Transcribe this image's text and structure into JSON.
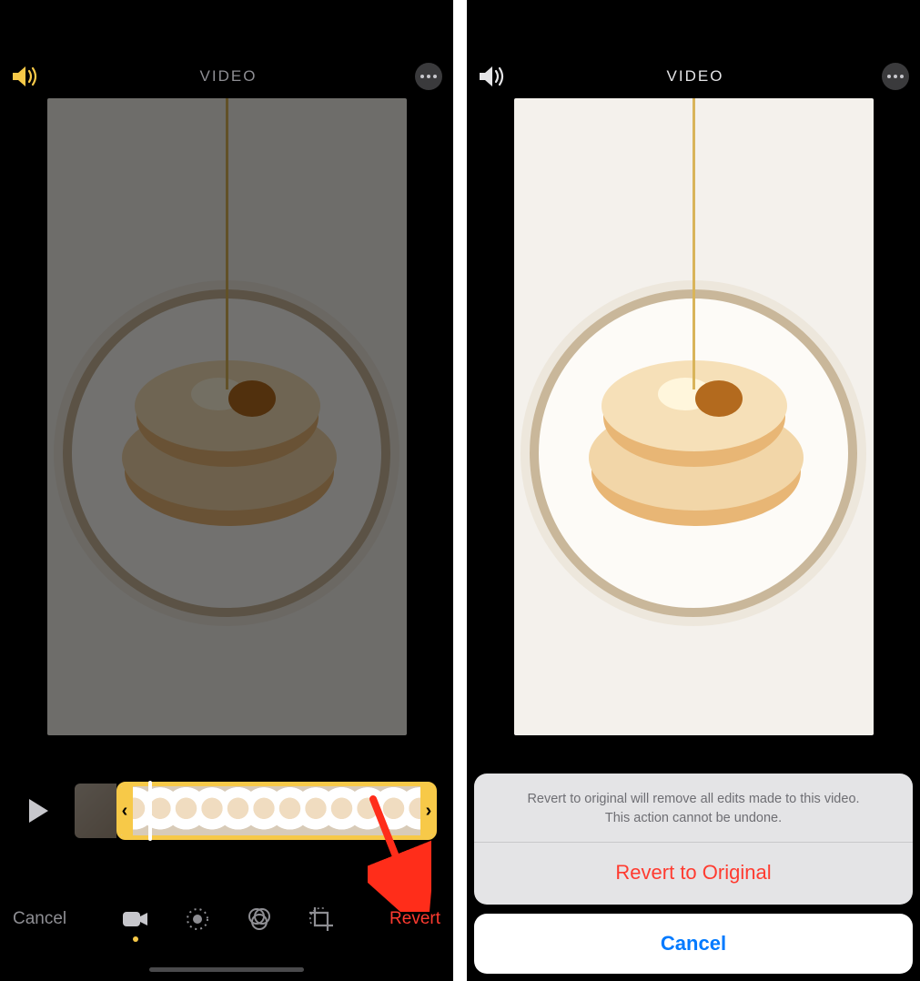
{
  "left": {
    "title": "VIDEO",
    "sound_icon": "sound-on-icon",
    "more_icon": "more-icon",
    "play_icon": "play-icon",
    "trim_left_glyph": "‹",
    "trim_right_glyph": "›",
    "toolbar": {
      "cancel": "Cancel",
      "revert": "Revert",
      "tools": {
        "video": "video-icon",
        "adjust": "adjust-icon",
        "filters": "filters-icon",
        "crop": "crop-icon"
      }
    }
  },
  "right": {
    "title": "VIDEO",
    "sound_icon": "sound-on-icon",
    "more_icon": "more-icon",
    "sheet": {
      "message_line1": "Revert to original will remove all edits made to this video.",
      "message_line2": "This action cannot be undone.",
      "revert_action": "Revert to Original",
      "cancel": "Cancel"
    }
  },
  "colors": {
    "accent_yellow": "#F7C948",
    "accent_red": "#FF3B30",
    "accent_blue": "#007AFF"
  }
}
